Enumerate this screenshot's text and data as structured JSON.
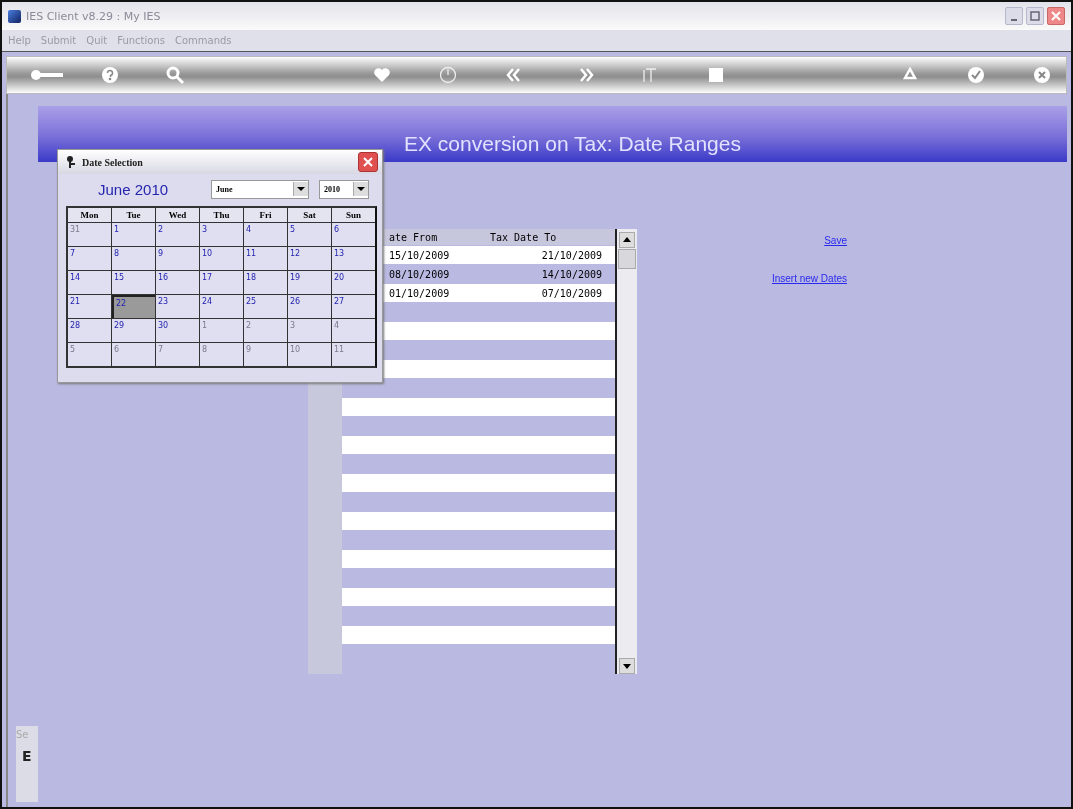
{
  "window": {
    "title": "IES Client v8.29 : My IES"
  },
  "menu": [
    "Help",
    "Submit",
    "Quit",
    "Functions",
    "Commands"
  ],
  "page_title": "EX conversion on Tax: Date Ranges",
  "table": {
    "columns": [
      "ate From",
      "Tax Date To"
    ],
    "rows": [
      {
        "cells": [
          "15/10/2009",
          "21/10/2009"
        ]
      },
      {
        "cells": [
          "08/10/2009",
          "14/10/2009"
        ]
      },
      {
        "cells": [
          "01/10/2009",
          "07/10/2009"
        ]
      }
    ]
  },
  "links": [
    "Save",
    "Insert new Dates"
  ],
  "side_panel": {
    "label": "Se",
    "value": "E"
  },
  "date_dialog": {
    "title": "Date Selection",
    "heading": "June 2010",
    "month": "June",
    "year": "2010",
    "weekdays": [
      "Mon",
      "Tue",
      "Wed",
      "Thu",
      "Fri",
      "Sat",
      "Sun"
    ],
    "weeks": [
      [
        {
          "day": "31",
          "other_month": true,
          "selected": false
        },
        {
          "day": "1",
          "other_month": false,
          "selected": false
        },
        {
          "day": "2",
          "other_month": false,
          "selected": false
        },
        {
          "day": "3",
          "other_month": false,
          "selected": false
        },
        {
          "day": "4",
          "other_month": false,
          "selected": false
        },
        {
          "day": "5",
          "other_month": false,
          "selected": false
        },
        {
          "day": "6",
          "other_month": false,
          "selected": false
        }
      ],
      [
        {
          "day": "7",
          "other_month": false,
          "selected": false
        },
        {
          "day": "8",
          "other_month": false,
          "selected": false
        },
        {
          "day": "9",
          "other_month": false,
          "selected": false
        },
        {
          "day": "10",
          "other_month": false,
          "selected": false
        },
        {
          "day": "11",
          "other_month": false,
          "selected": false
        },
        {
          "day": "12",
          "other_month": false,
          "selected": false
        },
        {
          "day": "13",
          "other_month": false,
          "selected": false
        }
      ],
      [
        {
          "day": "14",
          "other_month": false,
          "selected": false
        },
        {
          "day": "15",
          "other_month": false,
          "selected": false
        },
        {
          "day": "16",
          "other_month": false,
          "selected": false
        },
        {
          "day": "17",
          "other_month": false,
          "selected": false
        },
        {
          "day": "18",
          "other_month": false,
          "selected": false
        },
        {
          "day": "19",
          "other_month": false,
          "selected": false
        },
        {
          "day": "20",
          "other_month": false,
          "selected": false
        }
      ],
      [
        {
          "day": "21",
          "other_month": false,
          "selected": false
        },
        {
          "day": "22",
          "other_month": false,
          "selected": true
        },
        {
          "day": "23",
          "other_month": false,
          "selected": false
        },
        {
          "day": "24",
          "other_month": false,
          "selected": false
        },
        {
          "day": "25",
          "other_month": false,
          "selected": false
        },
        {
          "day": "26",
          "other_month": false,
          "selected": false
        },
        {
          "day": "27",
          "other_month": false,
          "selected": false
        }
      ],
      [
        {
          "day": "28",
          "other_month": false,
          "selected": false
        },
        {
          "day": "29",
          "other_month": false,
          "selected": false
        },
        {
          "day": "30",
          "other_month": false,
          "selected": false
        },
        {
          "day": "1",
          "other_month": true,
          "selected": false
        },
        {
          "day": "2",
          "other_month": true,
          "selected": false
        },
        {
          "day": "3",
          "other_month": true,
          "selected": false
        },
        {
          "day": "4",
          "other_month": true,
          "selected": false
        }
      ],
      [
        {
          "day": "5",
          "other_month": true,
          "selected": false
        },
        {
          "day": "6",
          "other_month": true,
          "selected": false
        },
        {
          "day": "7",
          "other_month": true,
          "selected": false
        },
        {
          "day": "8",
          "other_month": true,
          "selected": false
        },
        {
          "day": "9",
          "other_month": true,
          "selected": false
        },
        {
          "day": "10",
          "other_month": true,
          "selected": false
        },
        {
          "day": "11",
          "other_month": true,
          "selected": false
        }
      ]
    ]
  }
}
